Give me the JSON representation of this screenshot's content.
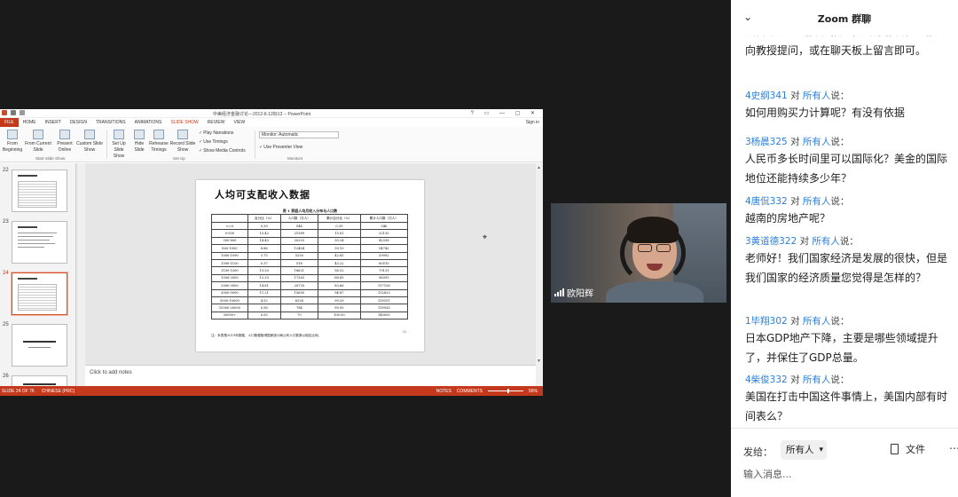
{
  "ppt": {
    "window_title": "中美经济金融讨论---2012-6-12标13 -- PowerPoint",
    "window_controls": "? ▭ — ▢ ✕",
    "tabs": [
      "FILE",
      "HOME",
      "INSERT",
      "DESIGN",
      "TRANSITIONS",
      "ANIMATIONS",
      "SLIDE SHOW",
      "REVIEW",
      "VIEW"
    ],
    "active_tab": "SLIDE SHOW",
    "sign_in": "Sign in",
    "ribbon": {
      "from_beginning": "From Beginning",
      "from_current": "From Current Slide",
      "present_online": "Present Online",
      "custom_show": "Custom Slide Show",
      "group_start": "Start Slide Show",
      "set_up_show": "Set Up Slide Show",
      "hide_slide": "Hide Slide",
      "rehearse": "Rehearse Timings",
      "record": "Record Slide Show",
      "play_narrations": "Play Narrations",
      "use_timings": "Use Timings",
      "show_media_controls": "Show Media Controls",
      "group_setup": "Set Up",
      "monitor": "Monitor: Automatic",
      "use_presenter_view": "Use Presenter View",
      "group_monitors": "Monitors"
    },
    "thumbnails": [
      {
        "num": "22",
        "selected": false
      },
      {
        "num": "23",
        "selected": false
      },
      {
        "num": "24",
        "selected": true
      },
      {
        "num": "25",
        "selected": false
      },
      {
        "num": "26",
        "selected": false
      }
    ],
    "slide": {
      "title": "人均可支配收入数据",
      "table_caption": "表 1 家庭人均月收入分布与人口数",
      "headers": [
        "",
        "百分比（%）",
        "人口数（万人）",
        "累计百分比（%）",
        "累计人口数（万人）"
      ],
      "rows": [
        [
          "<=0",
          "0.39",
          "546",
          "0.39",
          "546"
        ],
        [
          "0-500",
          "15.42",
          "21589",
          "15.81",
          "22135"
        ],
        [
          "500-800",
          "14.43",
          "20203",
          "30.24",
          "42338"
        ],
        [
          "800-1000",
          "8.86",
          "12404",
          "39.10",
          "54742"
        ],
        [
          "1000-1090",
          "3.75",
          "5250",
          "42.85",
          "59992"
        ],
        [
          "1090-1100",
          "0.37",
          "518",
          "43.22",
          "60510"
        ],
        [
          "1100-1500",
          "13.30",
          "18621",
          "56.52",
          "79131"
        ],
        [
          "1500-2000",
          "12.33",
          "17263",
          "68.85",
          "96393"
        ],
        [
          "2000-3000",
          "14.81",
          "20735",
          "83.66",
          "117128"
        ],
        [
          "3000-5000",
          "11.21",
          "15695",
          "94.87",
          "132823"
        ],
        [
          "5000-10000",
          "4.52",
          "6328",
          "99.39",
          "139151"
        ],
        [
          "10000-20000",
          "0.56",
          "784",
          "99.95",
          "139935"
        ],
        [
          "20000+",
          "0.05",
          "70",
          "100.00",
          "140005"
        ]
      ],
      "note": "注：本表是2019年数据，人口数据取得国家统计局公布人口数乘以相应比例。",
      "page_num": "33"
    },
    "notes_placeholder": "Click to add notes",
    "status": {
      "slide_info": "SLIDE 24 OF 76",
      "language": "CHINESE (PRC)",
      "notes": "NOTES",
      "comments": "COMMENTS",
      "zoom": "56%"
    }
  },
  "webcam": {
    "name": "欧阳辉"
  },
  "chat": {
    "title": "Zoom 群聊",
    "first_text": "设备下方的“静音”按钮，解除静音，直接向教授提问，或在聊天板上留言即可。",
    "to_word": "对",
    "target": "所有人",
    "colon": "说：",
    "messages": [
      {
        "sender": "4史纲341",
        "text": "如何用购买力计算呢？有没有依据"
      },
      {
        "sender": "3杨晨325",
        "text": "人民币多长时间里可以国际化？美金的国际地位还能持续多少年？"
      },
      {
        "sender": "4唐侃332",
        "text": "越南的房地产呢？"
      },
      {
        "sender": "3黄道德322",
        "text": "老师好！我们国家经济是发展的很快，但是我们国家的经济质量您觉得是怎样的？"
      },
      {
        "sender": "1毕翔302",
        "text": "日本GDP地产下降，主要是哪些领域提升了，并保住了GDP总量。"
      },
      {
        "sender": "4柴俊332",
        "text": "美国在打击中国这件事情上，美国内部有时间表么？"
      }
    ],
    "send_to_label": "发给：",
    "recipient": "所有人",
    "file_label": "文件",
    "input_placeholder": "输入消息..."
  }
}
